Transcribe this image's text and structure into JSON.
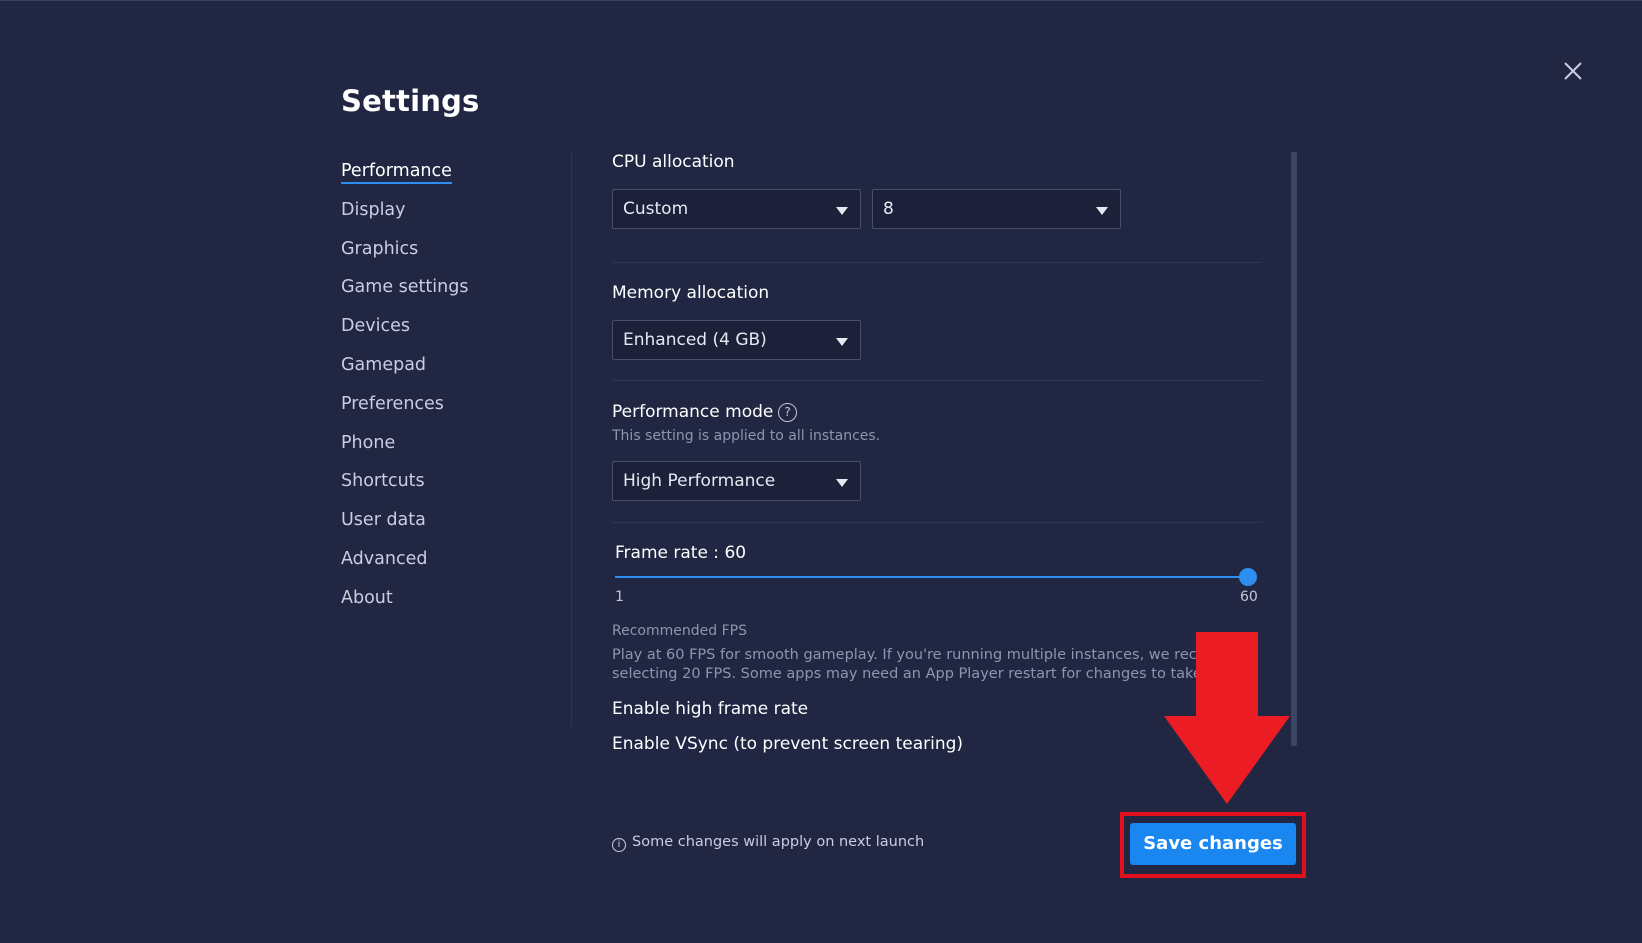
{
  "window": {
    "title": "Settings",
    "close_icon": "close-icon"
  },
  "sidebar": {
    "items": [
      {
        "label": "Performance",
        "active": true
      },
      {
        "label": "Display"
      },
      {
        "label": "Graphics"
      },
      {
        "label": "Game settings"
      },
      {
        "label": "Devices"
      },
      {
        "label": "Gamepad"
      },
      {
        "label": "Preferences"
      },
      {
        "label": "Phone"
      },
      {
        "label": "Shortcuts"
      },
      {
        "label": "User data"
      },
      {
        "label": "Advanced"
      },
      {
        "label": "About"
      }
    ]
  },
  "performance": {
    "cpu": {
      "label": "CPU allocation",
      "mode_value": "Custom",
      "cores_value": "8"
    },
    "memory": {
      "label": "Memory allocation",
      "value": "Enhanced (4 GB)"
    },
    "perf_mode": {
      "label": "Performance mode",
      "help_icon": "help-circle-icon",
      "help_glyph": "?",
      "sublabel": "This setting is applied to all instances.",
      "value": "High Performance"
    },
    "frame_rate": {
      "label": "Frame rate : 60",
      "value": 60,
      "min_label": "1",
      "max_label": "60",
      "recommended_title": "Recommended FPS",
      "recommended_line1": "Play at 60 FPS for smooth gameplay. If you're running multiple instances, we recomm",
      "recommended_line2": "selecting 20 FPS. Some apps may need an App Player restart for changes to take eff"
    },
    "high_frame_rate_label": "Enable high frame rate",
    "vsync_label": "Enable VSync (to prevent screen tearing)"
  },
  "footer": {
    "note_icon": "info-icon",
    "note_glyph": "i",
    "note": "Some changes will apply on next launch",
    "save_label": "Save changes"
  },
  "colors": {
    "background": "#212742",
    "accent": "#1a86ef",
    "highlight": "#e1101c"
  }
}
